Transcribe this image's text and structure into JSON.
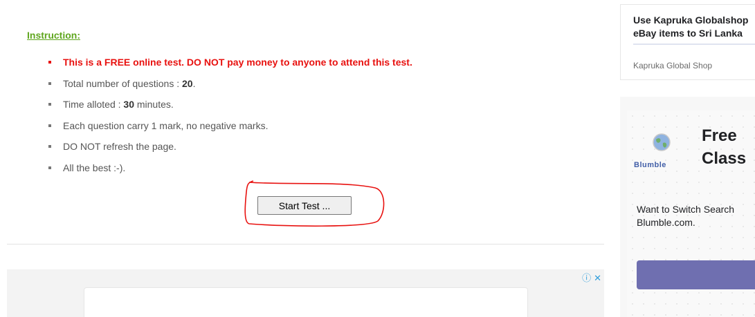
{
  "instructions": {
    "heading": "Instruction:",
    "warning": "This is a FREE online test. DO NOT pay money to anyone to attend this test.",
    "questions_prefix": "Total number of questions : ",
    "questions_count": "20",
    "questions_suffix": ".",
    "time_prefix": "Time alloted : ",
    "time_value": "30",
    "time_suffix": " minutes.",
    "marks": "Each question carry 1 mark, no negative marks.",
    "refresh": "DO NOT refresh the page.",
    "best": "All the best :-)."
  },
  "start_button": {
    "label": "Start Test ..."
  },
  "ads": {
    "top_right": {
      "title_line1": "Use Kapruka Globalshop",
      "title_line2": "eBay items to Sri Lanka",
      "source": "Kapruka Global Shop"
    },
    "blumble": {
      "brand": "Blumble",
      "headline_line1": "Free",
      "headline_line2": "Class",
      "body_line1": "Want to Switch Search",
      "body_line2": "Blumble.com."
    },
    "bottom": {
      "info_icon": "info-icon",
      "close_icon": "close-icon"
    }
  },
  "colors": {
    "heading_green": "#5fa61e",
    "warning_red": "#e8110f",
    "annotation_red": "#e8110f",
    "blumble_button": "#6f6fb0"
  }
}
